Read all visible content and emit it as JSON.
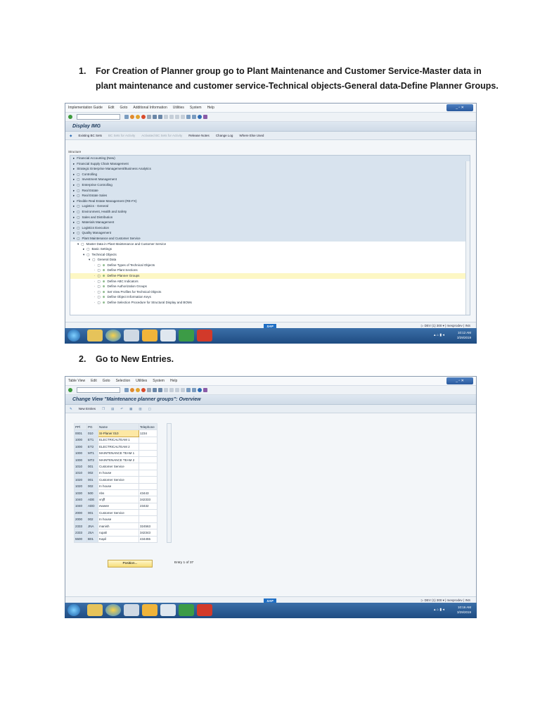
{
  "step1": {
    "num": "1.",
    "line1": "For Creation of Planner group  go to Plant Maintenance and Customer Service-Master data in",
    "line2": "plant maintenance and customer service-Technical objects-General data-Define Planner Groups."
  },
  "step2": {
    "num": "2.",
    "text": "Go to New Entries."
  },
  "shot1": {
    "menu": [
      "Implementation Guide",
      "Edit",
      "Goto",
      "Additional Information",
      "Utilities",
      "System",
      "Help"
    ],
    "title": "Display IMG",
    "app_toolbar": [
      "Existing BC Sets",
      "BC Sets for Activity",
      "Activated BC Sets for Activity",
      "Release Notes",
      "Change Log",
      "Where Else Used"
    ],
    "tree_header": "Structure",
    "tree": [
      "Financial Accounting (New)",
      "Financial Supply Chain Management",
      "Strategic Enterprise Management/Business Analytics",
      "Controlling",
      "Investment Management",
      "Enterprise Controlling",
      "Real Estate",
      "Real Estate Sales",
      "Flexible Real Estate Management (RE-FX)",
      "Logistics - General",
      "Environment, Health and Safety",
      "Sales and Distribution",
      "Materials Management",
      "Logistics Execution",
      "Quality Management",
      "Plant Maintenance and Customer Service",
      "Master Data in Plant Maintenance and Customer Service",
      "Basic Settings",
      "Technical Objects",
      "General Data",
      "Define Types of Technical Objects",
      "Define Plant Sections",
      "Define Planner Groups",
      "Define ABC Indicators",
      "Define Authorization Groups",
      "Set View Profiles for Technical Objects",
      "Define Object Information Keys",
      "Define Selection Procedure for Structural Display and BOMs"
    ],
    "status": "DEV (1) 300",
    "status_user": "mesprodev",
    "status_mode": "INS",
    "clock_time": "10:12 AM",
    "clock_date": "3/29/2019"
  },
  "shot2": {
    "menu": [
      "Table View",
      "Edit",
      "Goto",
      "Selection",
      "Utilities",
      "System",
      "Help"
    ],
    "title": "Change View \"Maintenance planner groups\": Overview",
    "new_entries": "New Entries",
    "columns": [
      "PPl",
      "PG",
      "Name",
      "Telephone"
    ],
    "rows": [
      [
        "0001",
        "010",
        "SI-Planer 010",
        "1234"
      ],
      [
        "1000",
        "ET1",
        "ELECTRICALTEAM 1",
        ""
      ],
      [
        "1000",
        "ET2",
        "ELECTRICALTEAM 2",
        ""
      ],
      [
        "1000",
        "MT1",
        "MAINTENANCE TEAM 1",
        ""
      ],
      [
        "1000",
        "MT2",
        "MAINTENANCE TEAM 2",
        ""
      ],
      [
        "1010",
        "001",
        "Customer Service",
        ""
      ],
      [
        "1010",
        "002",
        "In house",
        ""
      ],
      [
        "1020",
        "001",
        "Customer Service",
        ""
      ],
      [
        "1020",
        "002",
        "In house",
        ""
      ],
      [
        "1030",
        "500",
        "nbs",
        "43443"
      ],
      [
        "1040",
        "ADE",
        "vnjff",
        "342333"
      ],
      [
        "1040",
        "ADD",
        "ewwee",
        "23432"
      ],
      [
        "2000",
        "001",
        "Customer Service",
        ""
      ],
      [
        "2000",
        "002",
        "In house",
        ""
      ],
      [
        "2333",
        "JNA",
        "manish",
        "324563"
      ],
      [
        "2333",
        "JSA",
        "rupali",
        "342343"
      ],
      [
        "5500",
        "B01",
        "Kapil",
        "434455"
      ]
    ],
    "position_btn": "Position...",
    "entry_text": "Entry 1 of 37",
    "status": "DEV (1) 300",
    "status_user": "mesprodev",
    "status_mode": "INS",
    "clock_time": "10:16 AM",
    "clock_date": "3/29/2019"
  }
}
